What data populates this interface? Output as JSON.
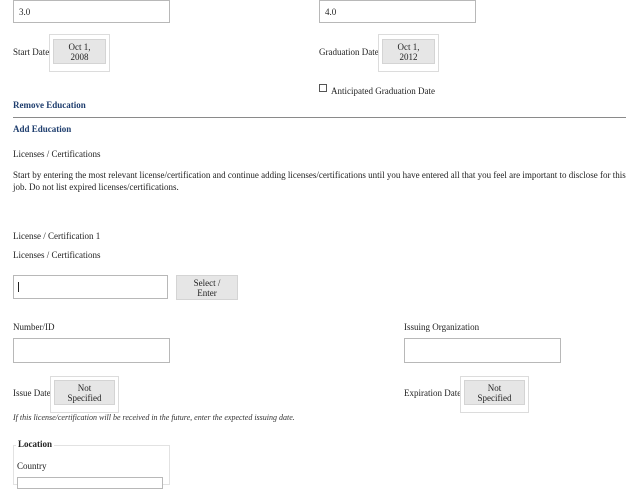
{
  "education": {
    "gpa_value": "3.0",
    "out_of_value": "4.0",
    "start_date_label": "Start Date",
    "start_date_value": "Oct 1, 2008",
    "graduation_date_label": "Graduation Date",
    "graduation_date_value": "Oct 1, 2012",
    "anticipated_label": "Anticipated Graduation Date",
    "remove_link": "Remove Education",
    "add_link": "Add Education"
  },
  "licenses": {
    "section_title": "Licenses / Certifications",
    "instructions": "Start by entering the most relevant license/certification and continue adding licenses/certifications until you have entered all that you feel are important to disclose for this job. Do not list expired licenses/certifications.",
    "item_title": "License / Certification 1",
    "field_label": "Licenses / Certifications",
    "field_value": "",
    "select_button": "Select / Enter",
    "number_label": "Number/ID",
    "number_value": "",
    "issuing_org_label": "Issuing Organization",
    "issuing_org_value": "",
    "issue_date_label": "Issue Date",
    "issue_date_value": "Not Specified",
    "expiration_date_label": "Expiration Date",
    "expiration_date_value": "Not Specified",
    "future_note": "If this license/certification will be received in the future, enter the expected issuing date.",
    "location_legend": "Location",
    "country_label": "Country"
  }
}
